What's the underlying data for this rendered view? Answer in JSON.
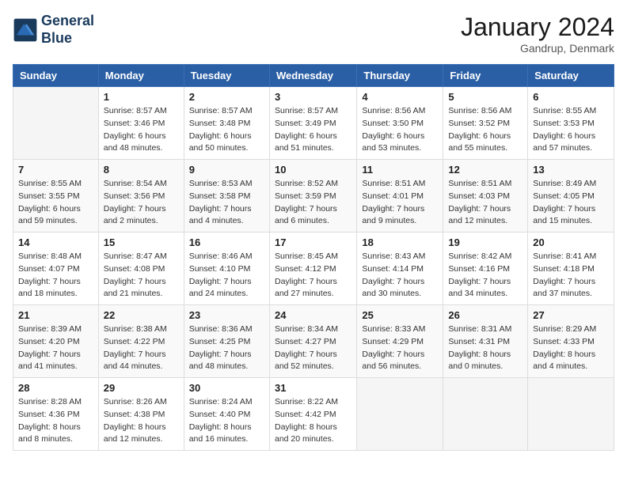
{
  "header": {
    "logo_line1": "General",
    "logo_line2": "Blue",
    "month_title": "January 2024",
    "location": "Gandrup, Denmark"
  },
  "weekdays": [
    "Sunday",
    "Monday",
    "Tuesday",
    "Wednesday",
    "Thursday",
    "Friday",
    "Saturday"
  ],
  "weeks": [
    [
      {
        "day": "",
        "info": ""
      },
      {
        "day": "1",
        "info": "Sunrise: 8:57 AM\nSunset: 3:46 PM\nDaylight: 6 hours\nand 48 minutes."
      },
      {
        "day": "2",
        "info": "Sunrise: 8:57 AM\nSunset: 3:48 PM\nDaylight: 6 hours\nand 50 minutes."
      },
      {
        "day": "3",
        "info": "Sunrise: 8:57 AM\nSunset: 3:49 PM\nDaylight: 6 hours\nand 51 minutes."
      },
      {
        "day": "4",
        "info": "Sunrise: 8:56 AM\nSunset: 3:50 PM\nDaylight: 6 hours\nand 53 minutes."
      },
      {
        "day": "5",
        "info": "Sunrise: 8:56 AM\nSunset: 3:52 PM\nDaylight: 6 hours\nand 55 minutes."
      },
      {
        "day": "6",
        "info": "Sunrise: 8:55 AM\nSunset: 3:53 PM\nDaylight: 6 hours\nand 57 minutes."
      }
    ],
    [
      {
        "day": "7",
        "info": "Sunrise: 8:55 AM\nSunset: 3:55 PM\nDaylight: 6 hours\nand 59 minutes."
      },
      {
        "day": "8",
        "info": "Sunrise: 8:54 AM\nSunset: 3:56 PM\nDaylight: 7 hours\nand 2 minutes."
      },
      {
        "day": "9",
        "info": "Sunrise: 8:53 AM\nSunset: 3:58 PM\nDaylight: 7 hours\nand 4 minutes."
      },
      {
        "day": "10",
        "info": "Sunrise: 8:52 AM\nSunset: 3:59 PM\nDaylight: 7 hours\nand 6 minutes."
      },
      {
        "day": "11",
        "info": "Sunrise: 8:51 AM\nSunset: 4:01 PM\nDaylight: 7 hours\nand 9 minutes."
      },
      {
        "day": "12",
        "info": "Sunrise: 8:51 AM\nSunset: 4:03 PM\nDaylight: 7 hours\nand 12 minutes."
      },
      {
        "day": "13",
        "info": "Sunrise: 8:49 AM\nSunset: 4:05 PM\nDaylight: 7 hours\nand 15 minutes."
      }
    ],
    [
      {
        "day": "14",
        "info": "Sunrise: 8:48 AM\nSunset: 4:07 PM\nDaylight: 7 hours\nand 18 minutes."
      },
      {
        "day": "15",
        "info": "Sunrise: 8:47 AM\nSunset: 4:08 PM\nDaylight: 7 hours\nand 21 minutes."
      },
      {
        "day": "16",
        "info": "Sunrise: 8:46 AM\nSunset: 4:10 PM\nDaylight: 7 hours\nand 24 minutes."
      },
      {
        "day": "17",
        "info": "Sunrise: 8:45 AM\nSunset: 4:12 PM\nDaylight: 7 hours\nand 27 minutes."
      },
      {
        "day": "18",
        "info": "Sunrise: 8:43 AM\nSunset: 4:14 PM\nDaylight: 7 hours\nand 30 minutes."
      },
      {
        "day": "19",
        "info": "Sunrise: 8:42 AM\nSunset: 4:16 PM\nDaylight: 7 hours\nand 34 minutes."
      },
      {
        "day": "20",
        "info": "Sunrise: 8:41 AM\nSunset: 4:18 PM\nDaylight: 7 hours\nand 37 minutes."
      }
    ],
    [
      {
        "day": "21",
        "info": "Sunrise: 8:39 AM\nSunset: 4:20 PM\nDaylight: 7 hours\nand 41 minutes."
      },
      {
        "day": "22",
        "info": "Sunrise: 8:38 AM\nSunset: 4:22 PM\nDaylight: 7 hours\nand 44 minutes."
      },
      {
        "day": "23",
        "info": "Sunrise: 8:36 AM\nSunset: 4:25 PM\nDaylight: 7 hours\nand 48 minutes."
      },
      {
        "day": "24",
        "info": "Sunrise: 8:34 AM\nSunset: 4:27 PM\nDaylight: 7 hours\nand 52 minutes."
      },
      {
        "day": "25",
        "info": "Sunrise: 8:33 AM\nSunset: 4:29 PM\nDaylight: 7 hours\nand 56 minutes."
      },
      {
        "day": "26",
        "info": "Sunrise: 8:31 AM\nSunset: 4:31 PM\nDaylight: 8 hours\nand 0 minutes."
      },
      {
        "day": "27",
        "info": "Sunrise: 8:29 AM\nSunset: 4:33 PM\nDaylight: 8 hours\nand 4 minutes."
      }
    ],
    [
      {
        "day": "28",
        "info": "Sunrise: 8:28 AM\nSunset: 4:36 PM\nDaylight: 8 hours\nand 8 minutes."
      },
      {
        "day": "29",
        "info": "Sunrise: 8:26 AM\nSunset: 4:38 PM\nDaylight: 8 hours\nand 12 minutes."
      },
      {
        "day": "30",
        "info": "Sunrise: 8:24 AM\nSunset: 4:40 PM\nDaylight: 8 hours\nand 16 minutes."
      },
      {
        "day": "31",
        "info": "Sunrise: 8:22 AM\nSunset: 4:42 PM\nDaylight: 8 hours\nand 20 minutes."
      },
      {
        "day": "",
        "info": ""
      },
      {
        "day": "",
        "info": ""
      },
      {
        "day": "",
        "info": ""
      }
    ]
  ]
}
